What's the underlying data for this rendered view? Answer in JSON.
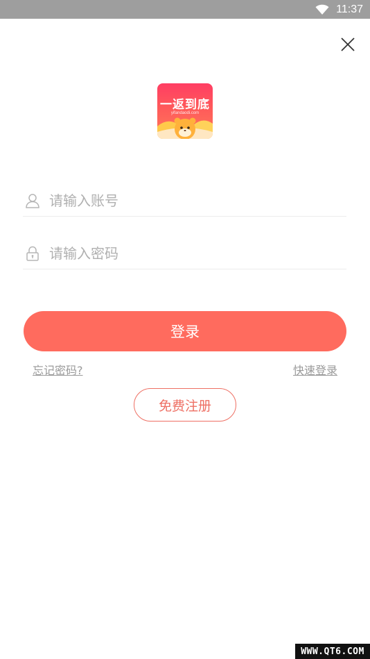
{
  "status_bar": {
    "time": "11:37",
    "wifi_icon": "wifi-icon"
  },
  "header": {
    "close_icon": "close-icon"
  },
  "logo": {
    "title": "一返到底",
    "domain": "yifandaodi.com",
    "colors": {
      "top": "#ff3d63",
      "bottom": "#ff7a59"
    }
  },
  "form": {
    "account": {
      "icon": "user-icon",
      "placeholder": "请输入账号",
      "value": ""
    },
    "password": {
      "icon": "lock-icon",
      "placeholder": "请输入密码",
      "value": ""
    }
  },
  "actions": {
    "login_label": "登录",
    "forgot_password": "忘记密码?",
    "quick_login": "快速登录",
    "register_label": "免费注册"
  },
  "colors": {
    "accent": "#ff6b5e",
    "register_border": "#ee6f63",
    "placeholder": "#b0b0b0",
    "link": "#9a9a9a"
  },
  "watermark": "WWW.QT6.COM"
}
